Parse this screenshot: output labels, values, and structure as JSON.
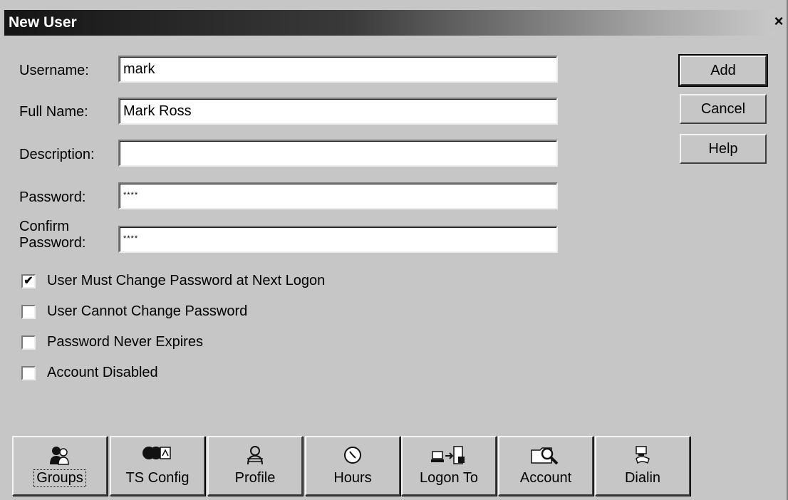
{
  "window": {
    "title": "New User",
    "close_glyph": "×"
  },
  "form": {
    "username_label": "Username:",
    "username_value": "mark",
    "fullname_label": "Full Name:",
    "fullname_value": "Mark Ross",
    "description_label": "Description:",
    "description_value": "",
    "password_label": "Password:",
    "password_value": "****",
    "confirm_label_line1": "Confirm",
    "confirm_label_line2": "Password:",
    "confirm_value": "****"
  },
  "buttons": {
    "add": "Add",
    "cancel": "Cancel",
    "help": "Help"
  },
  "checkboxes": [
    {
      "label": "User Must Change Password at Next Logon",
      "checked": true,
      "mark": "✔"
    },
    {
      "label": "User Cannot Change Password",
      "checked": false,
      "mark": ""
    },
    {
      "label": "Password Never Expires",
      "checked": false,
      "mark": ""
    },
    {
      "label": "Account Disabled",
      "checked": false,
      "mark": ""
    }
  ],
  "toolbar": [
    {
      "label": "Groups",
      "icon": "groups-icon"
    },
    {
      "label": "TS Config",
      "icon": "ts-config-icon"
    },
    {
      "label": "Profile",
      "icon": "profile-icon"
    },
    {
      "label": "Hours",
      "icon": "hours-icon"
    },
    {
      "label": "Logon To",
      "icon": "logon-to-icon"
    },
    {
      "label": "Account",
      "icon": "account-icon"
    },
    {
      "label": "Dialin",
      "icon": "dialin-icon"
    }
  ],
  "colors": {
    "face": "#c6c6c6",
    "title_start": "#151515",
    "title_end": "#c8c8c8"
  }
}
